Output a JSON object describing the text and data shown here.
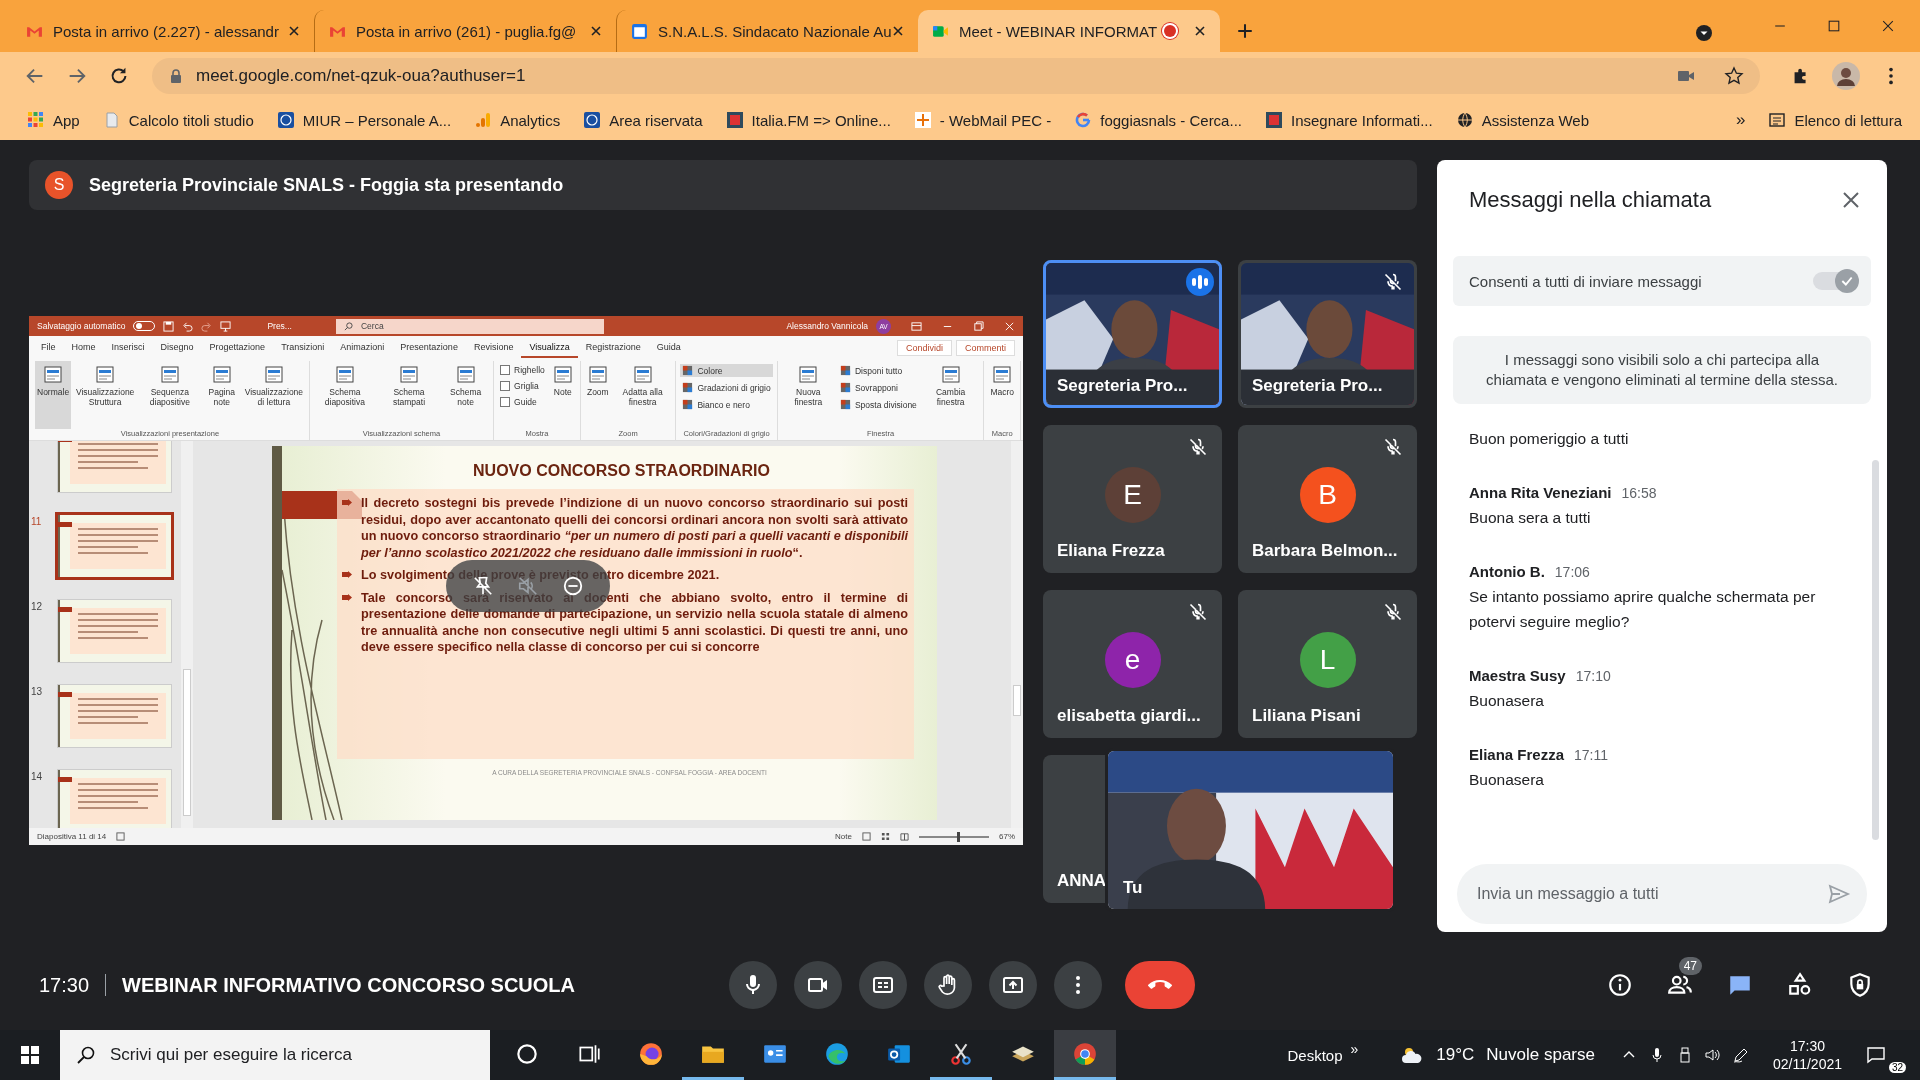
{
  "browser": {
    "tabs": [
      {
        "kind": "mail",
        "title": "Posta in arrivo (2.227) - alessandr",
        "selected": false,
        "recording": false
      },
      {
        "kind": "mail",
        "title": "Posta in arrivo (261) - puglia.fg@",
        "selected": false,
        "recording": false
      },
      {
        "kind": "calendar",
        "title": "S.N.A.L.S. Sindacato Nazionale Au",
        "selected": false,
        "recording": false
      },
      {
        "kind": "meet",
        "title": "Meet - WEBINAR INFORMAT",
        "selected": true,
        "recording": true
      }
    ],
    "address": "meet.google.com/net-qzuk-oua?authuser=1",
    "bookmarks": [
      {
        "kind": "grid",
        "label": "App"
      },
      {
        "kind": "page",
        "label": "Calcolo titoli studio"
      },
      {
        "kind": "seal",
        "label": "MIUR – Personale A..."
      },
      {
        "kind": "bars",
        "label": "Analytics"
      },
      {
        "kind": "seal",
        "label": "Area riservata"
      },
      {
        "kind": "square",
        "label": "Italia.FM => Online..."
      },
      {
        "kind": "star",
        "label": "- WebMail PEC -"
      },
      {
        "kind": "g",
        "label": "foggiasnals - Cerca..."
      },
      {
        "kind": "square",
        "label": "Insegnare Informati..."
      },
      {
        "kind": "globe",
        "label": "Assistenza Web"
      }
    ],
    "more": "»",
    "reading_list": "Elenco di lettura"
  },
  "banner": {
    "initial": "S",
    "text": "Segreteria Provinciale SNALS - Foggia sta presentando"
  },
  "powerpoint": {
    "autosave": "Salvataggio automatico",
    "autosave_on": false,
    "file": "Pres...",
    "search": "Cerca",
    "user": "Alessandro Vannicola",
    "user_initials": "AV",
    "tabs": [
      {
        "label": "File",
        "selected": false
      },
      {
        "label": "Home",
        "selected": false
      },
      {
        "label": "Inserisci",
        "selected": false
      },
      {
        "label": "Disegno",
        "selected": false
      },
      {
        "label": "Progettazione",
        "selected": false
      },
      {
        "label": "Transizioni",
        "selected": false
      },
      {
        "label": "Animazioni",
        "selected": false
      },
      {
        "label": "Presentazione",
        "selected": false
      },
      {
        "label": "Revisione",
        "selected": false
      },
      {
        "label": "Visualizza",
        "selected": true
      },
      {
        "label": "Registrazione",
        "selected": false
      },
      {
        "label": "Guida",
        "selected": false
      }
    ],
    "share": "Condividi",
    "comments": "Commenti",
    "ribbon_groups": [
      {
        "label": "Visualizzazioni presentazione",
        "items": [
          {
            "kind": "big",
            "label": "Normale",
            "selected": true
          },
          {
            "kind": "big",
            "label": "Visualizzazione Struttura",
            "selected": false
          },
          {
            "kind": "big",
            "label": "Sequenza diapositive",
            "selected": false
          },
          {
            "kind": "big",
            "label": "Pagina note",
            "selected": false
          },
          {
            "kind": "big",
            "label": "Visualizzazione di lettura",
            "selected": false
          }
        ]
      },
      {
        "label": "Visualizzazioni schema",
        "items": [
          {
            "kind": "big",
            "label": "Schema diapositiva",
            "selected": false
          },
          {
            "kind": "big",
            "label": "Schema stampati",
            "selected": false
          },
          {
            "kind": "big",
            "label": "Schema note",
            "selected": false
          }
        ]
      },
      {
        "label": "Mostra",
        "items": [
          {
            "kind": "check",
            "label": "Righello",
            "checked": false
          },
          {
            "kind": "check",
            "label": "Griglia",
            "checked": false
          },
          {
            "kind": "check",
            "label": "Guide",
            "checked": false
          },
          {
            "kind": "big",
            "label": "Note",
            "selected": false
          }
        ]
      },
      {
        "label": "Zoom",
        "items": [
          {
            "kind": "big",
            "label": "Zoom",
            "selected": false
          },
          {
            "kind": "big",
            "label": "Adatta alla finestra",
            "selected": false
          }
        ]
      },
      {
        "label": "Colori/Gradazioni di grigio",
        "items": [
          {
            "kind": "small",
            "label": "Colore",
            "selected": true
          },
          {
            "kind": "small",
            "label": "Gradazioni di grigio",
            "selected": false
          },
          {
            "kind": "small",
            "label": "Bianco e nero",
            "selected": false
          }
        ]
      },
      {
        "label": "Finestra",
        "items": [
          {
            "kind": "big",
            "label": "Nuova finestra",
            "selected": false
          },
          {
            "kind": "small",
            "label": "Disponi tutto",
            "selected": false
          },
          {
            "kind": "small",
            "label": "Sovrapponi",
            "selected": false
          },
          {
            "kind": "small",
            "label": "Sposta divisione",
            "selected": false
          },
          {
            "kind": "big",
            "label": "Cambia finestra",
            "selected": false
          }
        ]
      },
      {
        "label": "Macro",
        "items": [
          {
            "kind": "big",
            "label": "Macro",
            "selected": false
          }
        ]
      }
    ],
    "thumbnails": [
      {
        "selected": false
      },
      {
        "number": "11",
        "selected": true
      },
      {
        "number": "12",
        "selected": false
      },
      {
        "number": "13",
        "selected": false
      },
      {
        "number": "14",
        "selected": false
      }
    ],
    "slide": {
      "title": "NUOVO CONCORSO STRAORDINARIO",
      "bullets": [
        "Il decreto sostegni bis prevede l’indizione di un nuovo concorso straordinario sui posti residui, dopo aver accantonato quelli dei concorsi ordinari ancora non svolti sarà attivato un nuovo concorso straordinario  *“per un numero di posti pari a quelli vacanti e disponibili per l’anno scolastico 2021/2022 che residuano dalle immissioni in ruolo*“.",
        "Lo svolgimento delle prove è previsto entro dicembre 2021.",
        "Tale concorso sarà riservato ai docenti che abbiano svolto, entro il termine di presentazione delle domande di partecipazione, un servizio nella scuola statale di almeno tre annualità anche non consecutive negli ultimi 5 anni scolastici. Di questi tre anni, uno deve essere specifico nella classe di concorso per cui si concorre"
      ],
      "footer": "A CURA DELLA SEGRETERIA PROVINCIALE SNALS - CONFSAL FOGGIA - AREA DOCENTI"
    },
    "status": "Diapositiva 11 di 14",
    "notes": "Note",
    "zoom": "67%",
    "zoom_slider": {
      "level": 0.55
    }
  },
  "tiles": [
    {
      "kind": "video",
      "name": "Segreteria Pro...",
      "muted": false,
      "speaking": true
    },
    {
      "kind": "video",
      "name": "Segreteria Pro...",
      "muted": true,
      "speaking": false
    },
    {
      "kind": "avatar",
      "name": "Eliana Frezza",
      "initial": "E",
      "color": "#5d4037",
      "muted": true,
      "speaking": false
    },
    {
      "kind": "avatar",
      "name": "Barbara Belmon...",
      "initial": "B",
      "color": "#f4511e",
      "muted": true,
      "speaking": false
    },
    {
      "kind": "avatar",
      "name": "elisabetta giardi...",
      "initial": "e",
      "color": "#8e24aa",
      "muted": true,
      "speaking": false
    },
    {
      "kind": "avatar",
      "name": "Liliana Pisani",
      "initial": "L",
      "color": "#43a047",
      "muted": true,
      "speaking": false
    },
    {
      "kind": "covered",
      "name": "ANNA"
    }
  ],
  "self_view": {
    "label": "Tu"
  },
  "chat": {
    "title": "Messaggi nella chiamata",
    "allow": {
      "label": "Consenti a tutti di inviare messaggi",
      "on": true
    },
    "notice": "I messaggi sono visibili solo a chi partecipa alla chiamata e vengono eliminati al termine della stessa.",
    "messages": [
      {
        "text": "Buon pomeriggio a tutti"
      },
      {
        "sender": "Anna Rita Veneziani",
        "time": "16:58",
        "text": "Buona sera a tutti"
      },
      {
        "sender": "Antonio B.",
        "time": "17:06",
        "text": "Se intanto possiamo aprire qualche schermata per potervi seguire meglio?"
      },
      {
        "sender": "Maestra Susy",
        "time": "17:10",
        "text": "Buonasera"
      },
      {
        "sender": "Eliana Frezza",
        "time": "17:11",
        "text": "Buonasera"
      }
    ],
    "placeholder": "Invia un messaggio a tutti"
  },
  "call_bar": {
    "time": "17:30",
    "title": "WEBINAR INFORMATIVO CONCORSO SCUOLA",
    "controls": [
      {
        "kind": "mic"
      },
      {
        "kind": "camera"
      },
      {
        "kind": "captions"
      },
      {
        "kind": "hand"
      },
      {
        "kind": "present"
      },
      {
        "kind": "more"
      },
      {
        "kind": "hangup"
      }
    ],
    "side": [
      {
        "kind": "info",
        "selected": false
      },
      {
        "kind": "people",
        "selected": false,
        "badge": "47"
      },
      {
        "kind": "chat",
        "selected": true
      },
      {
        "kind": "activities",
        "selected": false
      },
      {
        "kind": "safety",
        "selected": false
      }
    ]
  },
  "taskbar": {
    "search": "Scrivi qui per eseguire la ricerca",
    "apps": [
      {
        "kind": "cortana",
        "open": false,
        "selected": false
      },
      {
        "kind": "taskview",
        "open": false,
        "selected": false
      },
      {
        "kind": "firefox",
        "open": false,
        "selected": false
      },
      {
        "kind": "folder",
        "open": true,
        "selected": false
      },
      {
        "kind": "contacts",
        "open": false,
        "selected": false
      },
      {
        "kind": "edge",
        "open": false,
        "selected": false
      },
      {
        "kind": "outlook",
        "open": false,
        "selected": false
      },
      {
        "kind": "snip",
        "open": true,
        "selected": false
      },
      {
        "kind": "stack",
        "open": false,
        "selected": false
      },
      {
        "kind": "chrome",
        "open": true,
        "selected": true
      }
    ],
    "desktop": "Desktop",
    "chevron": "»",
    "temperature": "19°C",
    "weather": "Nuvole sparse",
    "time": "17:30",
    "date": "02/11/2021",
    "notifications": "32"
  }
}
